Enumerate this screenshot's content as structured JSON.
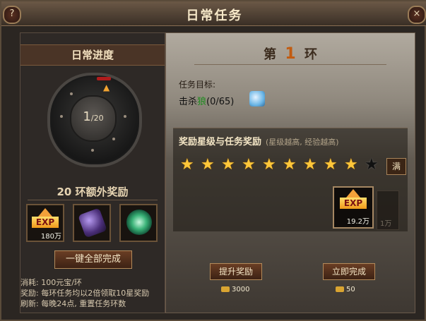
{
  "window": {
    "title": "日常任务"
  },
  "left": {
    "header": "日常进度",
    "progress": {
      "current": "1",
      "total": "/20"
    },
    "bonus_title": "20 环额外奖励",
    "rewards": [
      {
        "name": "EXP",
        "amount": "180万"
      },
      {
        "name": "purple-gem",
        "amount": ""
      },
      {
        "name": "green-orb",
        "amount": ""
      }
    ],
    "complete_all_label": "一键全部完成",
    "info_lines": [
      "消耗: 100元宝/环",
      "奖励: 每环任务均以2倍领取10星奖励",
      "刷新: 每晚24点, 重置任务环数"
    ]
  },
  "right": {
    "round_prefix": "第",
    "round_number": "1",
    "round_suffix": "环",
    "goal_label": "任务目标:",
    "goal_text_prefix": "击杀",
    "goal_target": "狼",
    "goal_progress": "(0/65)",
    "reward_heading": "奖励星级与任务奖励",
    "reward_sub": "(星级越高, 经验越高)",
    "stars": {
      "filled": 9,
      "total": 10
    },
    "full_label": "满",
    "exp_reward": {
      "label": "EXP",
      "amount": "19.2万"
    },
    "exp_next": {
      "amount": "1万"
    },
    "upgrade_label": "提升奖励",
    "upgrade_cost": "3000",
    "instant_label": "立即完成",
    "instant_cost": "50"
  },
  "colors": {
    "accent": "#c25b10",
    "star": "#ffc73a",
    "target_green": "#1e8b1e"
  }
}
